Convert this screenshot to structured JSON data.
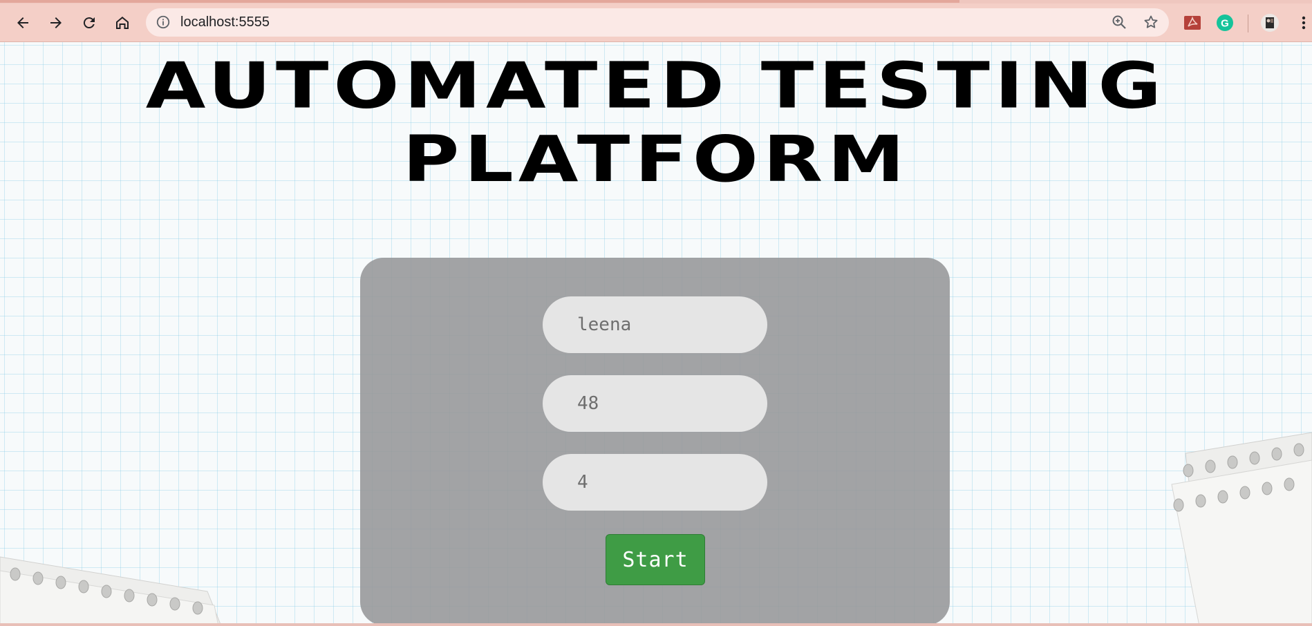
{
  "browser": {
    "url": "localhost:5555",
    "icons": {
      "back": "arrow-left-icon",
      "forward": "arrow-right-icon",
      "reload": "reload-icon",
      "home": "home-icon",
      "info": "info-icon",
      "zoom": "zoom-in-icon",
      "bookmark": "star-icon",
      "pdf_extension": "acrobat-icon",
      "grammarly_extension": "grammarly-icon",
      "profile": "avatar",
      "menu": "more-vert-icon"
    },
    "colors": {
      "chrome": "#f4cfc7",
      "omnibox": "#fbe9e6",
      "grammarly": "#15c39a",
      "acrobat": "#b5413a"
    }
  },
  "page": {
    "title": "AUTOMATED TESTING PLATFORM",
    "form": {
      "field1_value": "leena",
      "field2_value": "48",
      "field3_value": "4",
      "start_label": "Start"
    },
    "colors": {
      "panel": "#969698",
      "field": "#e5e5e5",
      "start_button": "#3f9c45",
      "grid": "#82c8e6"
    }
  }
}
